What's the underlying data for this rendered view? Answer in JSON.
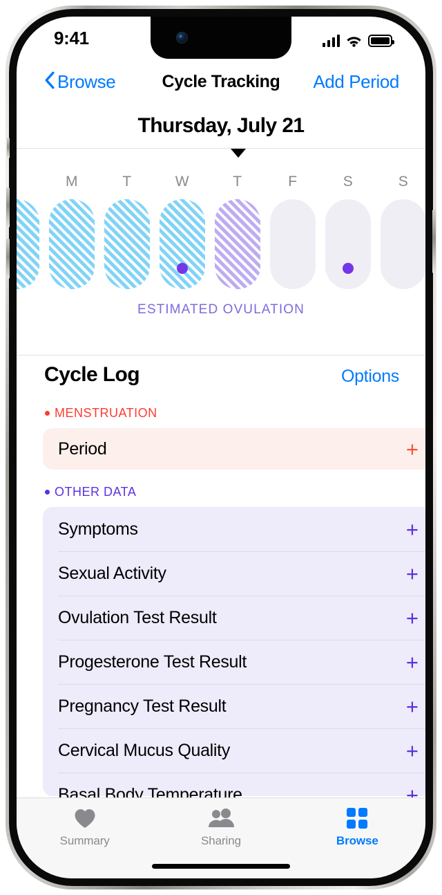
{
  "status_bar": {
    "time": "9:41",
    "signal_icon": "cellular-signal-icon",
    "wifi_icon": "wifi-icon",
    "battery_icon": "battery-full-icon"
  },
  "nav_bar": {
    "back_icon": "chevron-left-icon",
    "back_label": "Browse",
    "title": "Cycle Tracking",
    "action_label": "Add Period"
  },
  "date_header": {
    "title": "Thursday, July 21"
  },
  "week_strip": {
    "selected_marker_icon": "triangle-down-marker",
    "weekdays": [
      "M",
      "T",
      "W",
      "T",
      "F",
      "S",
      "S"
    ],
    "ovulation_caption": "ESTIMATED OVULATION",
    "days": [
      {
        "weekday": "",
        "state": "fertile",
        "dot": false,
        "partial": "left"
      },
      {
        "weekday": "M",
        "state": "fertile",
        "dot": false,
        "partial": "none"
      },
      {
        "weekday": "T",
        "state": "fertile",
        "dot": false,
        "partial": "none"
      },
      {
        "weekday": "W",
        "state": "fertile",
        "dot": true,
        "partial": "none"
      },
      {
        "weekday": "T",
        "state": "ovulation",
        "dot": false,
        "partial": "none"
      },
      {
        "weekday": "F",
        "state": "plain",
        "dot": false,
        "partial": "none"
      },
      {
        "weekday": "S",
        "state": "plain",
        "dot": true,
        "partial": "none"
      },
      {
        "weekday": "S",
        "state": "plain",
        "dot": false,
        "partial": "none"
      },
      {
        "weekday": "",
        "state": "plain",
        "dot": true,
        "partial": "right"
      }
    ]
  },
  "cycle_log": {
    "title": "Cycle Log",
    "options_label": "Options",
    "menstruation": {
      "section_label": "MENSTRUATION",
      "section_color": "#ff3b30",
      "rows": [
        {
          "label": "Period",
          "add_icon": "plus-icon"
        }
      ]
    },
    "other_data": {
      "section_label": "OTHER DATA",
      "section_color": "#5b32e0",
      "rows": [
        {
          "label": "Symptoms",
          "add_icon": "plus-icon"
        },
        {
          "label": "Sexual Activity",
          "add_icon": "plus-icon"
        },
        {
          "label": "Ovulation Test Result",
          "add_icon": "plus-icon"
        },
        {
          "label": "Progesterone Test Result",
          "add_icon": "plus-icon"
        },
        {
          "label": "Pregnancy Test Result",
          "add_icon": "plus-icon"
        },
        {
          "label": "Cervical Mucus Quality",
          "add_icon": "plus-icon"
        },
        {
          "label": "Basal Body Temperature",
          "add_icon": "plus-icon"
        }
      ]
    }
  },
  "tab_bar": {
    "tabs": [
      {
        "label": "Summary",
        "icon": "heart-icon",
        "active": false
      },
      {
        "label": "Sharing",
        "icon": "people-icon",
        "active": false
      },
      {
        "label": "Browse",
        "icon": "grid-icon",
        "active": true
      }
    ]
  },
  "colors": {
    "accent_blue": "#007aff",
    "menstruation_red": "#ff3b30",
    "period_plus_red": "#ff4f3a",
    "other_purple": "#5b32e0",
    "ovulation_caption_purple": "#7d6bdd",
    "fertile_stripe": "#7dd2f7",
    "ovulation_stripe": "#bba9f2",
    "plain_pill": "#f0eef5",
    "dot_purple": "#7336e8"
  }
}
